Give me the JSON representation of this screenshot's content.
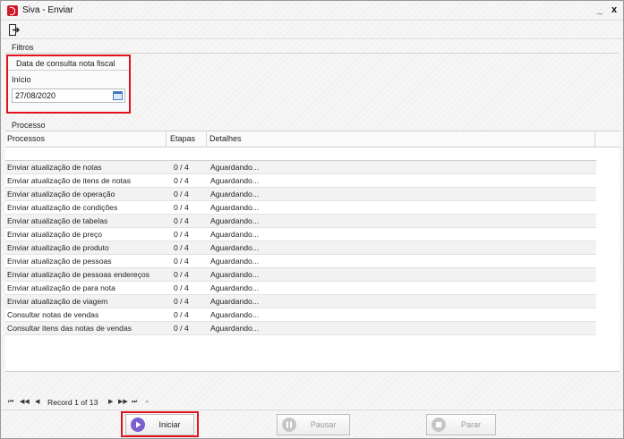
{
  "window": {
    "title": "Siva - Enviar",
    "minimize": "_",
    "close": "x"
  },
  "toolbar": {
    "exit_icon": "exit-icon"
  },
  "filtros": {
    "label": "Filtros",
    "group_caption": "Data de consulta nota fiscal",
    "inicio_label": "Início",
    "inicio_value": "27/08/2020"
  },
  "processo": {
    "label": "Processo",
    "columns": [
      "Processos",
      "Etapas",
      "Detalhes"
    ],
    "rows": [
      {
        "processo": "Enviar atualização de notas",
        "etapas": "0 / 4",
        "detalhes": "Aguardando..."
      },
      {
        "processo": "Enviar atualização de itens de notas",
        "etapas": "0 / 4",
        "detalhes": "Aguardando..."
      },
      {
        "processo": "Enviar atualização de operação",
        "etapas": "0 / 4",
        "detalhes": "Aguardando..."
      },
      {
        "processo": "Enviar atualização de condições",
        "etapas": "0 / 4",
        "detalhes": "Aguardando..."
      },
      {
        "processo": "Enviar atualização de tabelas",
        "etapas": "0 / 4",
        "detalhes": "Aguardando..."
      },
      {
        "processo": "Enviar atualização de preço",
        "etapas": "0 / 4",
        "detalhes": "Aguardando..."
      },
      {
        "processo": "Enviar atualização de produto",
        "etapas": "0 / 4",
        "detalhes": "Aguardando..."
      },
      {
        "processo": "Enviar atualização de pessoas",
        "etapas": "0 / 4",
        "detalhes": "Aguardando..."
      },
      {
        "processo": "Enviar atualização de pessoas endereços",
        "etapas": "0 / 4",
        "detalhes": "Aguardando..."
      },
      {
        "processo": "Enviar atualização de para nota",
        "etapas": "0 / 4",
        "detalhes": "Aguardando..."
      },
      {
        "processo": "Enviar atualização de viagem",
        "etapas": "0 / 4",
        "detalhes": "Aguardando..."
      },
      {
        "processo": "Consultar notas de vendas",
        "etapas": "0 / 4",
        "detalhes": "Aguardando..."
      },
      {
        "processo": "Consultar itens das notas de vendas",
        "etapas": "0 / 4",
        "detalhes": "Aguardando..."
      }
    ]
  },
  "navigator": {
    "first": "⏮",
    "prev_page": "◀◀",
    "prev": "◀",
    "record_text": "Record 1 of 13",
    "next": "▶",
    "next_page": "▶▶",
    "last": "⏭",
    "scroll_left": "◂"
  },
  "buttons": {
    "iniciar": "Iniciar",
    "pausar": "Pausar",
    "parar": "Parar"
  },
  "colors": {
    "highlight": "#e0131b",
    "play": "#7b5fd0",
    "disabled_icon": "#bdbdbd"
  }
}
